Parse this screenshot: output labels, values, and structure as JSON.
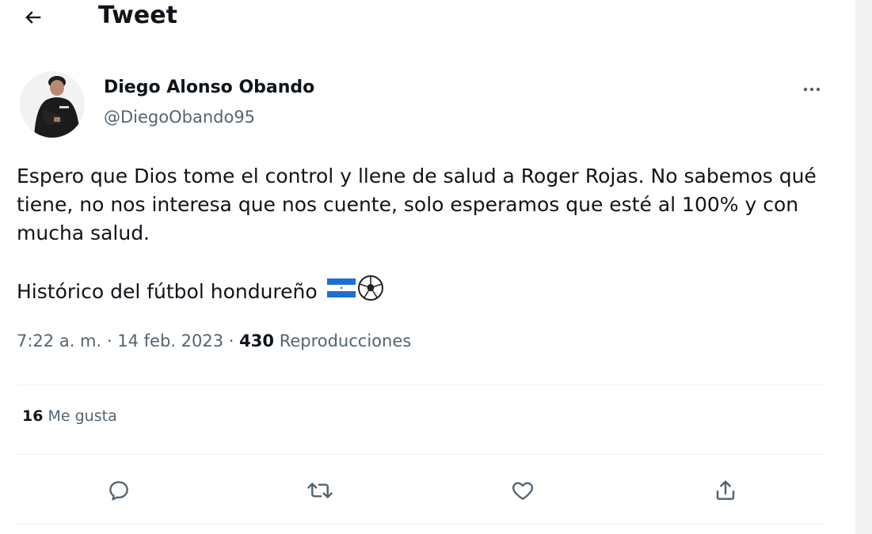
{
  "header": {
    "title": "Tweet",
    "back_icon": "arrow-left-icon"
  },
  "author": {
    "name": "Diego Alonso Obando",
    "handle": "@DiegoObando95",
    "more_icon": "more-horizontal-icon"
  },
  "tweet": {
    "paragraph1": "Espero que Dios tome el control y llene de salud a Roger Rojas. No sabemos qué tiene, no nos interesa que nos cuente, solo esperamos que esté al 100% y con mucha salud.",
    "paragraph2": "Histórico del fútbol hondureño",
    "emojis": [
      "honduras-flag-icon",
      "soccer-ball-icon"
    ]
  },
  "meta": {
    "time": "7:22 a. m.",
    "separator": "·",
    "date": "14 feb. 2023",
    "views_count": "430",
    "views_label": "Reproducciones"
  },
  "stats": {
    "likes_count": "16",
    "likes_label": "Me gusta"
  },
  "actions": [
    {
      "name": "reply",
      "icon": "reply-icon"
    },
    {
      "name": "retweet",
      "icon": "retweet-icon"
    },
    {
      "name": "like",
      "icon": "heart-icon"
    },
    {
      "name": "share",
      "icon": "share-icon"
    }
  ],
  "colors": {
    "text_primary": "#0f1419",
    "text_secondary": "#536471",
    "divider": "#eff3f4",
    "flag_blue": "#1f6fd1"
  }
}
